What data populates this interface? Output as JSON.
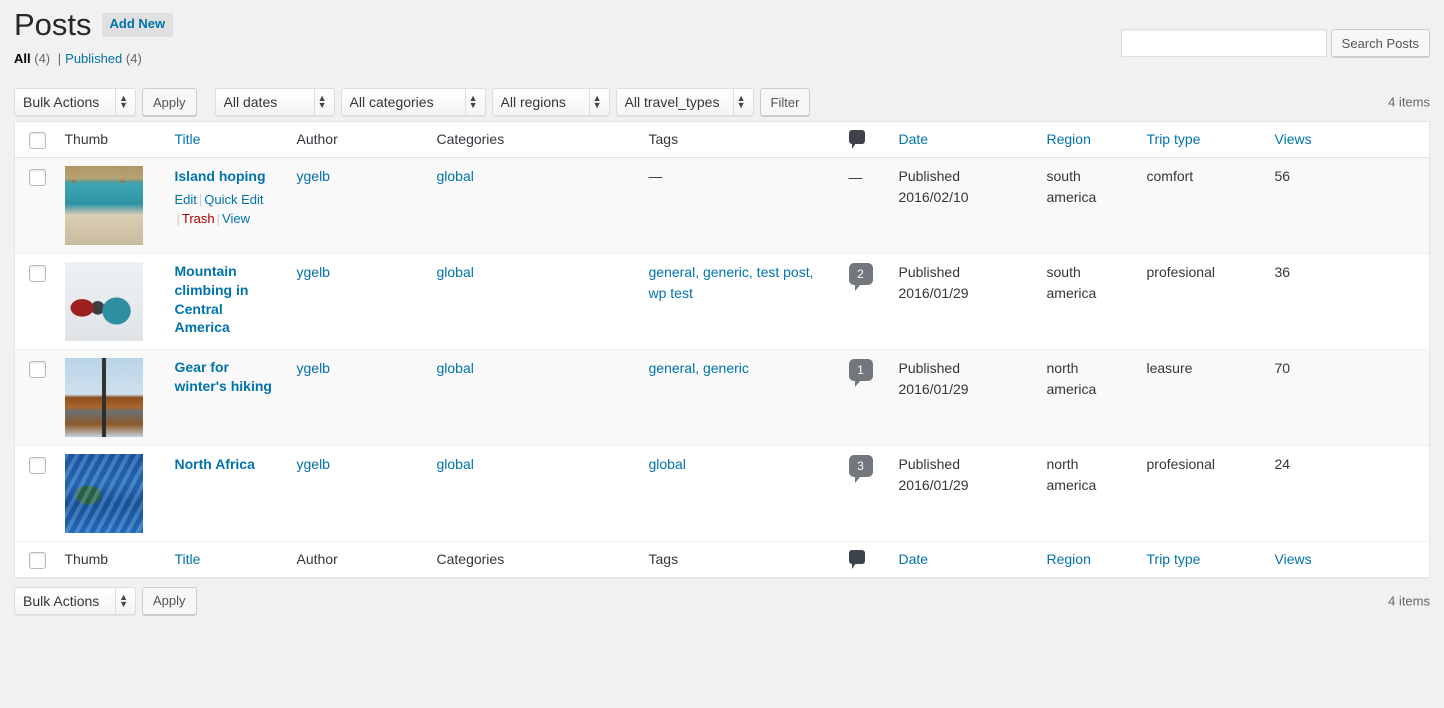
{
  "page": {
    "title": "Posts",
    "add_new_label": "Add New"
  },
  "status_links": [
    {
      "label": "All",
      "count": "(4)",
      "current": true
    },
    {
      "label": "Published",
      "count": "(4)",
      "current": false
    }
  ],
  "search": {
    "value": "",
    "placeholder": "",
    "button_label": "Search Posts"
  },
  "tablenav_top": {
    "bulk_actions_label": "Bulk Actions",
    "apply_label": "Apply",
    "dates_label": "All dates",
    "categories_label": "All categories",
    "regions_label": "All regions",
    "travel_types_label": "All travel_types",
    "filter_label": "Filter",
    "displaying_num": "4 items"
  },
  "tablenav_bottom": {
    "bulk_actions_label": "Bulk Actions",
    "apply_label": "Apply",
    "displaying_num": "4 items"
  },
  "columns": {
    "thumb": "Thumb",
    "title": "Title",
    "author": "Author",
    "categories": "Categories",
    "tags": "Tags",
    "comments": "comment-bubble-icon",
    "date": "Date",
    "region": "Region",
    "trip_type": "Trip type",
    "views": "Views"
  },
  "row_actions": {
    "edit": "Edit",
    "quick_edit": "Quick Edit",
    "trash": "Trash",
    "view": "View"
  },
  "rows": [
    {
      "title": "Island hoping",
      "author": "ygelb",
      "categories": "global",
      "tags": "—",
      "tags_is_dash": true,
      "comments": "—",
      "comments_is_dash": true,
      "date_status": "Published",
      "date_value": "2016/02/10",
      "region": "south america",
      "trip_type": "comfort",
      "views": "56",
      "has_actions": true,
      "thumb_alt": "beach-chairs-thumbnail"
    },
    {
      "title": "Mountain climbing in Central America",
      "author": "ygelb",
      "categories": "global",
      "tags": "general, generic, test post, wp test",
      "tags_is_dash": false,
      "comments": "2",
      "comments_is_dash": false,
      "date_status": "Published",
      "date_value": "2016/01/29",
      "region": "south america",
      "trip_type": "profesional",
      "views": "36",
      "has_actions": false,
      "thumb_alt": "mountain-climbers-thumbnail"
    },
    {
      "title": "Gear for winter's hiking",
      "author": "ygelb",
      "categories": "global",
      "tags": "general, generic",
      "tags_is_dash": false,
      "comments": "1",
      "comments_is_dash": false,
      "date_status": "Published",
      "date_value": "2016/01/29",
      "region": "north america",
      "trip_type": "leasure",
      "views": "70",
      "has_actions": false,
      "thumb_alt": "autumn-lake-thumbnail"
    },
    {
      "title": "North Africa",
      "author": "ygelb",
      "categories": "global",
      "tags": "global",
      "tags_is_dash": false,
      "comments": "3",
      "comments_is_dash": false,
      "date_status": "Published",
      "date_value": "2016/01/29",
      "region": "north america",
      "trip_type": "profesional",
      "views": "24",
      "has_actions": false,
      "thumb_alt": "blue-boats-thumbnail"
    }
  ],
  "colors": {
    "link": "#0073aa",
    "trash_link": "#a00",
    "page_bg": "#f1f1f1",
    "table_bg": "#ffffff",
    "alt_row_bg": "#f9f9f9",
    "comment_badge_bg": "#72777c",
    "heading_text": "#23282d"
  }
}
